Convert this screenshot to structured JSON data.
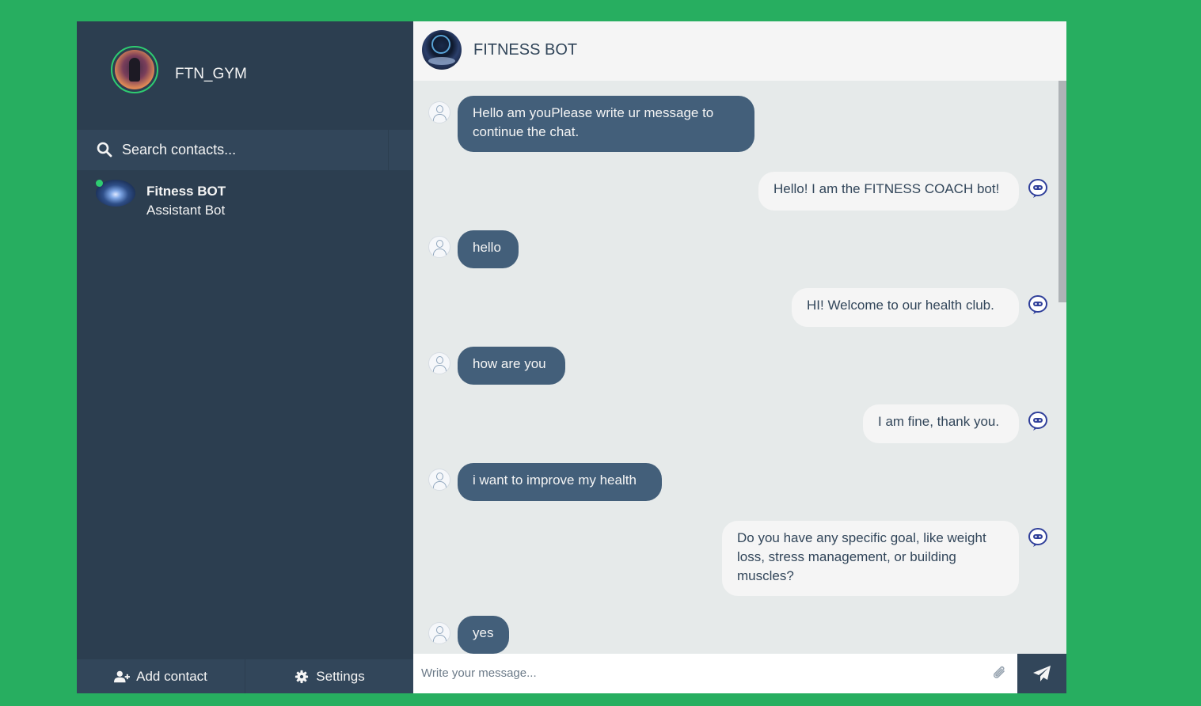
{
  "sidebar": {
    "profile": {
      "name": "FTN_GYM"
    },
    "search": {
      "placeholder": "Search contacts..."
    },
    "contacts": [
      {
        "name": "Fitness BOT",
        "preview": "Assistant Bot",
        "status": "online"
      }
    ],
    "bottom": {
      "add_contact": "Add contact",
      "settings": "Settings"
    }
  },
  "chat": {
    "title": "FITNESS BOT",
    "messages": [
      {
        "type": "sent",
        "text": "Hello am youPlease write ur message to continue the chat."
      },
      {
        "type": "replies",
        "text": "Hello! I am the FITNESS COACH bot!"
      },
      {
        "type": "sent",
        "text": "hello"
      },
      {
        "type": "replies",
        "text": "HI! Welcome to our health club."
      },
      {
        "type": "sent",
        "text": "how are you"
      },
      {
        "type": "replies",
        "text": "I am fine, thank you."
      },
      {
        "type": "sent",
        "text": "i want to improve my health"
      },
      {
        "type": "replies",
        "text": "Do you have any specific goal, like weight loss, stress management, or building muscles?"
      },
      {
        "type": "sent",
        "text": "yes"
      }
    ],
    "input": {
      "placeholder": "Write your message..."
    }
  },
  "colors": {
    "page_bg": "#27ae60",
    "sidebar_bg": "#2c3e50",
    "sent_bubble": "#435f7a",
    "reply_bubble": "#f5f5f5",
    "online": "#2ecc71"
  }
}
